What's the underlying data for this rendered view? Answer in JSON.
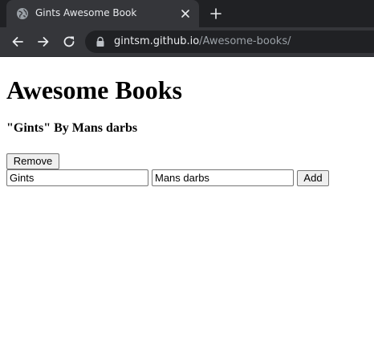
{
  "browser": {
    "tab": {
      "title": "Gints Awesome Book",
      "favicon": "globe-icon"
    },
    "icons": {
      "close": "close-icon",
      "new_tab": "plus-icon",
      "back": "back-arrow-icon",
      "forward": "forward-arrow-icon",
      "reload": "reload-icon",
      "lock": "lock-icon"
    },
    "address": {
      "host": "gintsm.github.io",
      "path": "/Awesome-books/"
    },
    "colors": {
      "tabstrip_bg": "#202124",
      "toolbar_bg": "#35363a",
      "text_primary": "#e8eaed",
      "text_muted": "#9aa0a6"
    }
  },
  "page": {
    "heading": "Awesome Books",
    "books": [
      {
        "entry": "\"Gints\" By Mans darbs",
        "remove_label": "Remove"
      }
    ],
    "form": {
      "title_value": "Gints",
      "author_value": "Mans darbs",
      "add_label": "Add"
    }
  }
}
